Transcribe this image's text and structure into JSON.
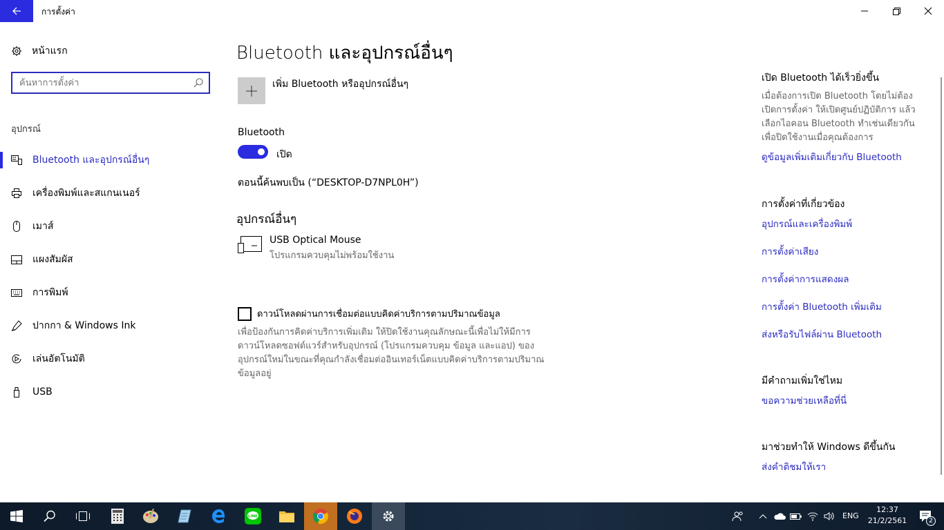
{
  "window": {
    "title": "การตั้งค่า"
  },
  "sidebar": {
    "home_label": "หน้าแรก",
    "search_placeholder": "ค้นหาการตั้งค่า",
    "section_label": "อุปกรณ์",
    "items": [
      {
        "label": "Bluetooth และอุปกรณ์อื่นๆ",
        "icon": "bluetooth-devices-icon",
        "active": true
      },
      {
        "label": "เครื่องพิมพ์และสแกนเนอร์",
        "icon": "printer-icon"
      },
      {
        "label": "เมาส์",
        "icon": "mouse-icon"
      },
      {
        "label": "แผงสัมผัส",
        "icon": "touchpad-icon"
      },
      {
        "label": "การพิมพ์",
        "icon": "keyboard-icon"
      },
      {
        "label": "ปากกา & Windows Ink",
        "icon": "pen-icon"
      },
      {
        "label": "เล่นอัตโนมัติ",
        "icon": "autoplay-icon"
      },
      {
        "label": "USB",
        "icon": "usb-icon"
      }
    ]
  },
  "main": {
    "title": "Bluetooth และอุปกรณ์อื่นๆ",
    "add_device_label": "เพิ่ม Bluetooth หรืออุปกรณ์อื่นๆ",
    "bluetooth_label": "Bluetooth",
    "toggle_state": "เปิด",
    "discoverable": "ตอนนี้ค้นพบเป็น (“DESKTOP-D7NPL0H”)",
    "other_devices_heading": "อุปกรณ์อื่นๆ",
    "device": {
      "name": "USB Optical Mouse",
      "status": "โปรแกรมควบคุมไม่พร้อมใช้งาน"
    },
    "metered_label": "ดาวน์โหลดผ่านการเชื่อมต่อแบบคิดค่าบริการตามปริมาณข้อมูล",
    "metered_desc": "เพื่อป้องกันการคิดค่าบริการเพิ่มเติม ให้ปิดใช้งานคุณลักษณะนี้เพื่อไม่ให้มีการดาวน์โหลดซอฟต์แวร์สำหรับอุปกรณ์ (โปรแกรมควบคุม ข้อมูล และแอป) ของอุปกรณ์ใหม่ในขณะที่คุณกำลังเชื่อมต่ออินเทอร์เน็ตแบบคิดค่าบริการตามปริมาณข้อมูลอยู่"
  },
  "right": {
    "quick_heading": "เปิด Bluetooth ได้เร็วยิ่งขึ้น",
    "quick_desc": "เมื่อต้องการเปิด Bluetooth โดยไม่ต้องเปิดการตั้งค่า ให้เปิดศูนย์ปฏิบัติการ แล้วเลือกไอคอน Bluetooth ทำเช่นเดียวกันเพื่อปิดใช้งานเมื่อคุณต้องการ",
    "learn_more": "ดูข้อมูลเพิ่มเติมเกี่ยวกับ Bluetooth",
    "related_heading": "การตั้งค่าที่เกี่ยวข้อง",
    "related_links": [
      "อุปกรณ์และเครื่องพิมพ์",
      "การตั้งค่าเสียง",
      "การตั้งค่าการแสดงผล",
      "การตั้งค่า Bluetooth เพิ่มเติม",
      "ส่งหรือรับไฟล์ผ่าน Bluetooth"
    ],
    "question_heading": "มีคำถามเพิ่มใช่ไหม",
    "help_link": "ขอความช่วยเหลือที่นี่",
    "improve_heading": "มาช่วยทำให้ Windows ดีขึ้นกัน",
    "feedback_link": "ส่งคำติชมให้เรา"
  },
  "taskbar": {
    "language": "ENG",
    "time": "12:37",
    "date": "21/2/2561",
    "notification_count": "2"
  },
  "colors": {
    "accent": "#2b2be0",
    "link": "#2b2bc0"
  }
}
